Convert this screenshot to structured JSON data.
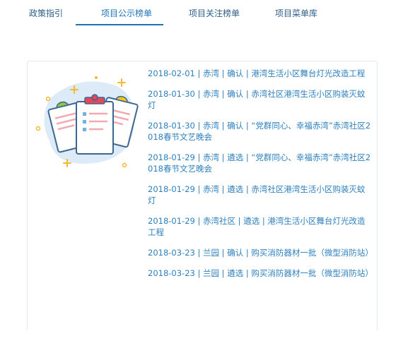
{
  "tabs": [
    {
      "label": "政策指引"
    },
    {
      "label": "项目公示榜单"
    },
    {
      "label": "项目关注榜单"
    },
    {
      "label": "项目菜单库"
    }
  ],
  "projects": [
    {
      "text": "2018-02-01 | 赤湾 | 确认 | 港湾生活小区舞台灯光改造工程"
    },
    {
      "text": "2018-01-30 | 赤湾 | 确认 | 赤湾社区港湾生活小区购装灭蚊灯"
    },
    {
      "text": "2018-01-30 | 赤湾 | 确认 | “党群同心、幸福赤湾”赤湾社区2018春节文艺晚会"
    },
    {
      "text": "2018-01-29 | 赤湾 | 遴选 | “党群同心、幸福赤湾”赤湾社区2018春节文艺晚会"
    },
    {
      "text": "2018-01-29 | 赤湾 | 遴选 | 赤湾社区港湾生活小区购装灭蚊灯"
    },
    {
      "text": "2018-01-29 | 赤湾社区 | 遴选 | 港湾生活小区舞台灯光改造工程"
    },
    {
      "text": "2018-03-23 | 兰园 | 确认 | 购买消防器材一批（微型消防站）"
    },
    {
      "text": "2018-03-23 | 兰园 | 遴选 | 购买消防器材一批（微型消防站）"
    }
  ],
  "colors": {
    "accent": "#1e74b8",
    "link": "#2e7fbd",
    "tab_text": "#2d5f87",
    "illustration_blob": "#dcebf7",
    "paper_border": "#3d6690",
    "clip_red": "#e8475a",
    "clip_yellow": "#f5c518",
    "clip_green": "#8dc63f",
    "sparkle": "#f7b733"
  },
  "icons": {
    "illustration": "clipboard-documents-illustration"
  }
}
